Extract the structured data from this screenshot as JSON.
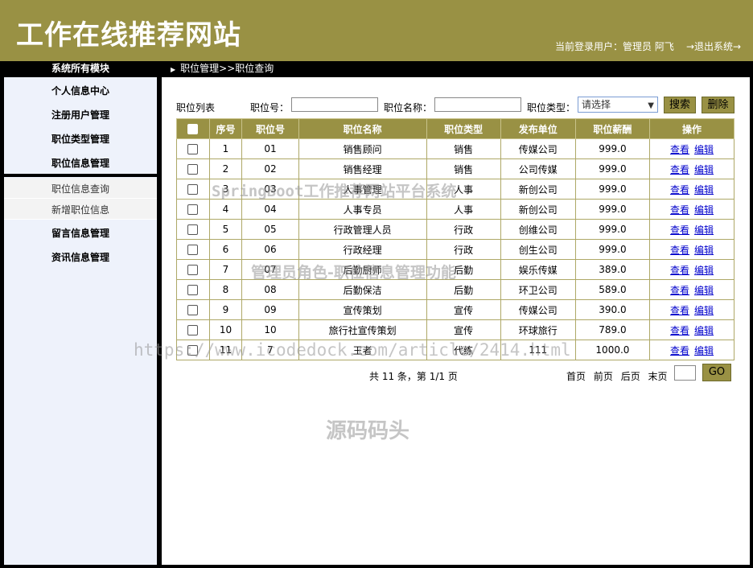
{
  "header": {
    "site_title": "工作在线推荐网站",
    "user_info": "当前登录用户：管理员 阿飞",
    "logout": "→退出系统→"
  },
  "nav": {
    "modules_title": "系统所有模块",
    "breadcrumb": "职位管理>>职位查询"
  },
  "sidebar": {
    "items": [
      "个人信息中心",
      "注册用户管理",
      "职位类型管理",
      "职位信息管理"
    ],
    "subitems": [
      "职位信息查询",
      "新增职位信息"
    ],
    "items_after": [
      "留言信息管理",
      "资讯信息管理"
    ]
  },
  "toolbar": {
    "list_label": "职位列表",
    "job_no_label": "职位号：",
    "job_name_label": "职位名称：",
    "job_type_label": "职位类型：",
    "job_type_value": "请选择",
    "search_btn": "搜索",
    "delete_btn": "删除"
  },
  "table": {
    "headers": [
      "序号",
      "职位号",
      "职位名称",
      "职位类型",
      "发布单位",
      "职位薪酬",
      "操作"
    ],
    "view_label": "查看",
    "edit_label": "编辑",
    "rows": [
      [
        "1",
        "01",
        "销售顾问",
        "销售",
        "传媒公司",
        "999.0"
      ],
      [
        "2",
        "02",
        "销售经理",
        "销售",
        "公司传媒",
        "999.0"
      ],
      [
        "3",
        "03",
        "人事管理",
        "人事",
        "新创公司",
        "999.0"
      ],
      [
        "4",
        "04",
        "人事专员",
        "人事",
        "新创公司",
        "999.0"
      ],
      [
        "5",
        "05",
        "行政管理人员",
        "行政",
        "创维公司",
        "999.0"
      ],
      [
        "6",
        "06",
        "行政经理",
        "行政",
        "创生公司",
        "999.0"
      ],
      [
        "7",
        "07",
        "后勤厨师",
        "后勤",
        "娱乐传媒",
        "389.0"
      ],
      [
        "8",
        "08",
        "后勤保洁",
        "后勤",
        "环卫公司",
        "589.0"
      ],
      [
        "9",
        "09",
        "宣传策划",
        "宣传",
        "传媒公司",
        "390.0"
      ],
      [
        "10",
        "10",
        "旅行社宣传策划",
        "宣传",
        "环球旅行",
        "789.0"
      ],
      [
        "11",
        "7",
        "王者",
        "代练",
        "111",
        "1000.0"
      ]
    ]
  },
  "pager": {
    "count": "共 11 条，第 1/1 页",
    "first": "首页",
    "prev": "前页",
    "next": "后页",
    "last": "末页",
    "go": "GO"
  },
  "watermarks": {
    "line1": "SpringBoot工作推荐网站平台系统",
    "line2": "管理员角色-职位信息管理功能",
    "line3": "https://www.icodedock.com/article/2414.html",
    "line4": "源码码头"
  },
  "colors": {
    "brand": "#999144",
    "sidebar_bg": "#eef2fb",
    "link": "#0000cc"
  }
}
